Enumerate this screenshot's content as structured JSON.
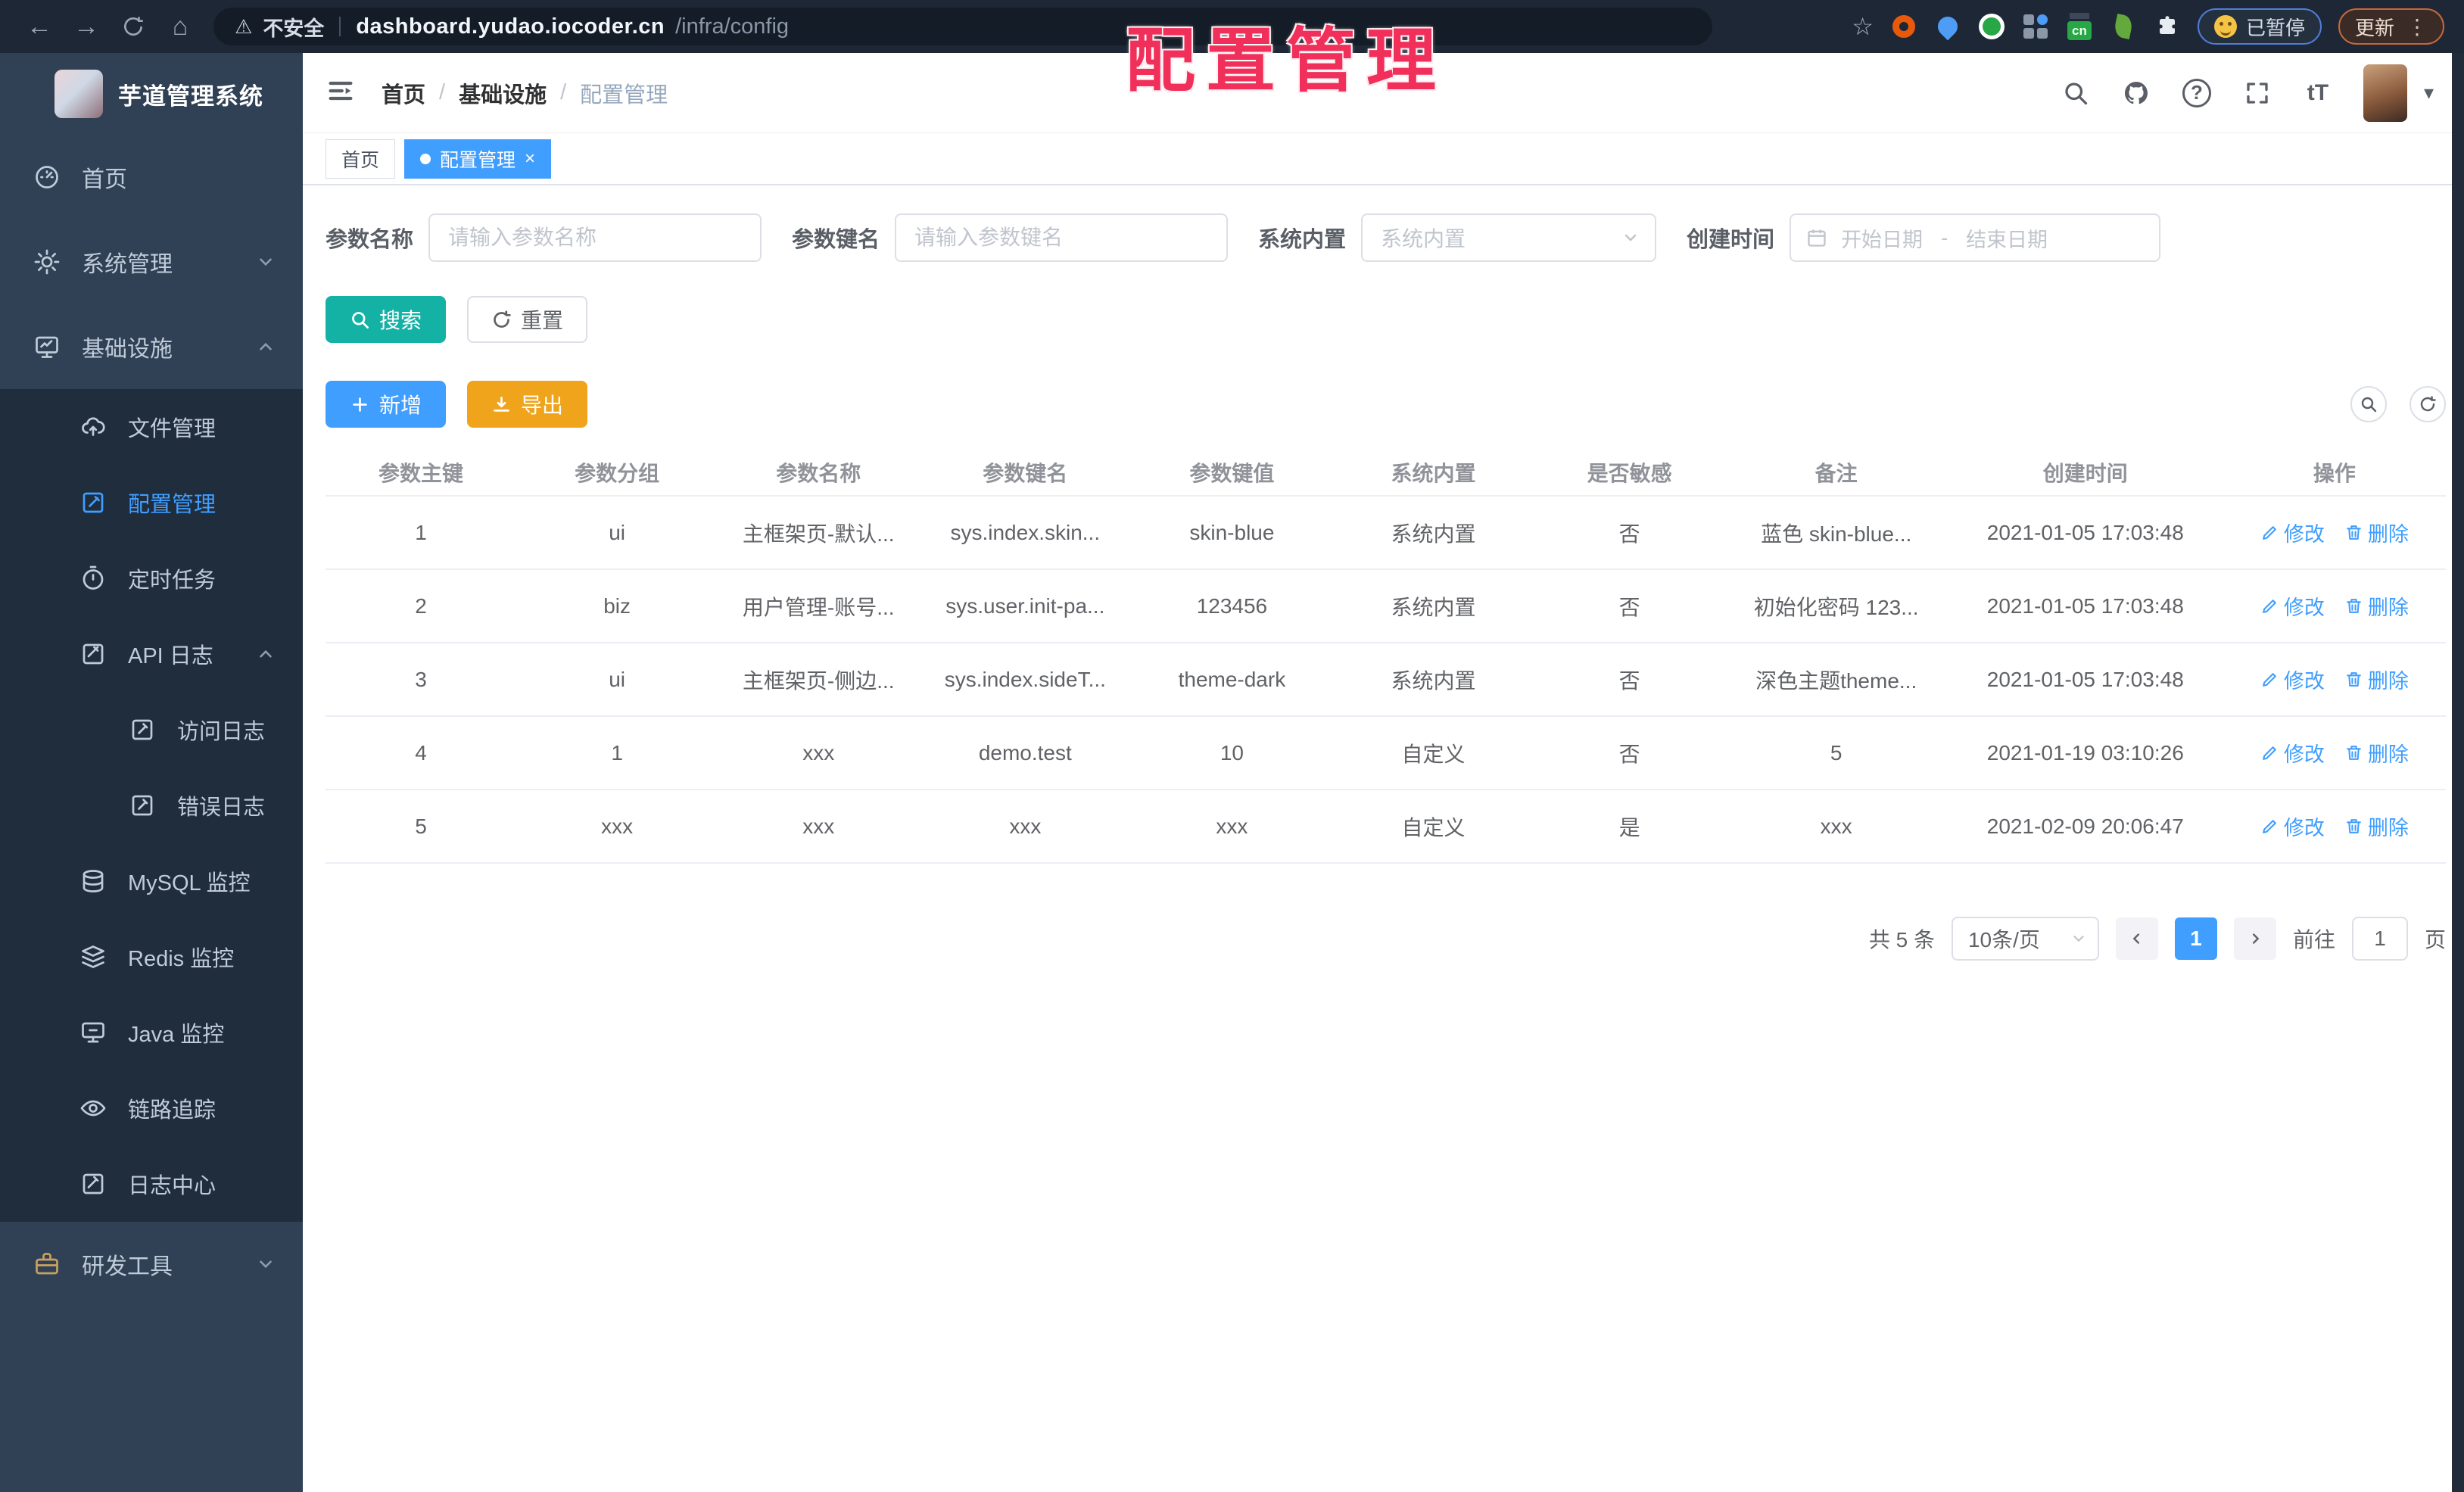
{
  "browser": {
    "back_icon": "←",
    "forward_icon": "→",
    "home_icon": "⌂",
    "warning_icon": "⚠",
    "security_label": "不安全",
    "url_host": "dashboard.yudao.iocoder.cn",
    "url_path": "/infra/config",
    "bookmark_icon": "☆",
    "cn_badge": "cn",
    "paused_label": "已暂停",
    "update_label": "更新",
    "kebab_icon": "⋮"
  },
  "overlay": {
    "title": "配置管理"
  },
  "sidebar": {
    "app_title": "芋道管理系统",
    "items": [
      {
        "label": "首页"
      },
      {
        "label": "系统管理"
      },
      {
        "label": "基础设施"
      },
      {
        "label": "文件管理"
      },
      {
        "label": "配置管理"
      },
      {
        "label": "定时任务"
      },
      {
        "label": "API 日志"
      },
      {
        "label": "访问日志"
      },
      {
        "label": "错误日志"
      },
      {
        "label": "MySQL 监控"
      },
      {
        "label": "Redis 监控"
      },
      {
        "label": "Java 监控"
      },
      {
        "label": "链路追踪"
      },
      {
        "label": "日志中心"
      },
      {
        "label": "研发工具"
      }
    ]
  },
  "header": {
    "breadcrumb": [
      "首页",
      "基础设施",
      "配置管理"
    ],
    "separator": "/",
    "font_size_icon": "tT",
    "question_icon": "?",
    "caret_icon": "▾"
  },
  "tabs": [
    {
      "label": "首页"
    },
    {
      "label": "配置管理",
      "close_icon": "×"
    }
  ],
  "filters": {
    "name_label": "参数名称",
    "name_placeholder": "请输入参数名称",
    "key_label": "参数键名",
    "key_placeholder": "请输入参数键名",
    "type_label": "系统内置",
    "type_placeholder": "系统内置",
    "date_label": "创建时间",
    "date_start": "开始日期",
    "date_separator": "-",
    "date_end": "结束日期",
    "search_label": "搜索",
    "reset_label": "重置"
  },
  "toolbar": {
    "add_label": "新增",
    "export_label": "导出"
  },
  "table": {
    "columns": [
      "参数主键",
      "参数分组",
      "参数名称",
      "参数键名",
      "参数键值",
      "系统内置",
      "是否敏感",
      "备注",
      "创建时间",
      "操作"
    ],
    "rows": [
      [
        "1",
        "ui",
        "主框架页-默认...",
        "sys.index.skin...",
        "skin-blue",
        "系统内置",
        "否",
        "蓝色 skin-blue...",
        "2021-01-05 17:03:48"
      ],
      [
        "2",
        "biz",
        "用户管理-账号...",
        "sys.user.init-pa...",
        "123456",
        "系统内置",
        "否",
        "初始化密码 123...",
        "2021-01-05 17:03:48"
      ],
      [
        "3",
        "ui",
        "主框架页-侧边...",
        "sys.index.sideT...",
        "theme-dark",
        "系统内置",
        "否",
        "深色主题theme...",
        "2021-01-05 17:03:48"
      ],
      [
        "4",
        "1",
        "xxx",
        "demo.test",
        "10",
        "自定义",
        "否",
        "5",
        "2021-01-19 03:10:26"
      ],
      [
        "5",
        "xxx",
        "xxx",
        "xxx",
        "xxx",
        "自定义",
        "是",
        "xxx",
        "2021-02-09 20:06:47"
      ]
    ],
    "edit_label": "修改",
    "delete_label": "删除"
  },
  "pagination": {
    "total": "共 5 条",
    "page_size": "10条/页",
    "current_page": "1",
    "goto_label": "前往",
    "goto_value": "1",
    "page_unit": "页"
  },
  "colors": {
    "accent": "#409eff",
    "sidebar_bg": "#304156",
    "submenu_bg": "#1f2d3d",
    "search_button": "#14b1a5",
    "export_button": "#efa41c",
    "overlay_red": "#f0305a"
  }
}
